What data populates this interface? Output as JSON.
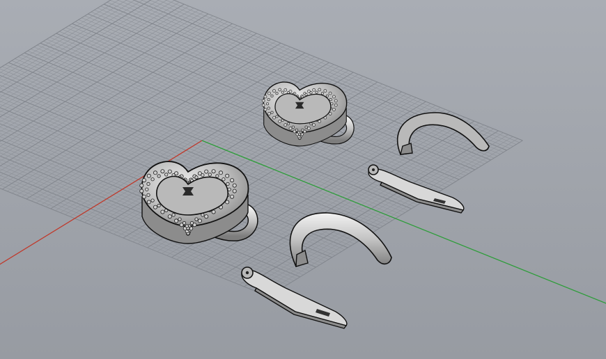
{
  "viewport": {
    "projection": "perspective",
    "show_grid": true,
    "axis_colors": {
      "x": "#c0392b",
      "y": "#2e9d3a"
    },
    "background": "#9fa3aa",
    "grid_color": "#8d9198"
  },
  "objects": [
    {
      "name": "heart-padlock",
      "count": 2
    },
    {
      "name": "curved-shackle",
      "count": 2
    },
    {
      "name": "hinge-tongue-plate",
      "count": 2
    }
  ]
}
